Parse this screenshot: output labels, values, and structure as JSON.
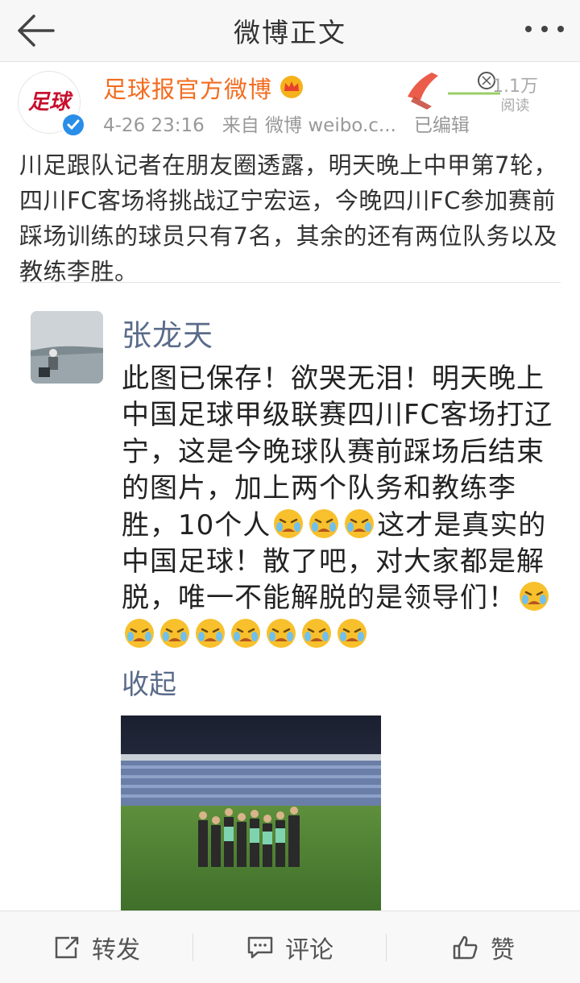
{
  "nav": {
    "title": "微博正文"
  },
  "post": {
    "author": "足球报官方微博",
    "avatar_text": "足球",
    "date": "4-26 23:16",
    "source": "来自 微博 weibo.c...",
    "edited": "已编辑",
    "reads": "1.1万",
    "reads_label": "阅读",
    "text": "川足跟队记者在朋友圈透露，明天晚上中甲第7轮，四川FC客场将挑战辽宁宏运，今晚四川FC参加赛前踩场训练的球员只有7名，其余的还有两位队务以及教练李胜。"
  },
  "embedded": {
    "name": "张龙天",
    "text_part1": "此图已保存！欲哭无泪！明天晚上中国足球甲级联赛四川FC客场打辽宁，这是今晚球队赛前踩场后结束的图片，加上两个队务和教练李胜，10个人",
    "text_part2": "这才是真实的中国足球！散了吧，对大家都是解脱，唯一不能解脱的是领导们！",
    "collapse": "收起"
  },
  "actions": {
    "repost": "转发",
    "comment": "评论",
    "like": "赞"
  },
  "colors": {
    "author": "#f36c1f",
    "link": "#5a6b8a",
    "verified": "#2a8ee8"
  },
  "icons": [
    "back-arrow-icon",
    "more-dots-icon",
    "crown-icon",
    "verified-icon",
    "crying-emoji-icon",
    "repost-icon",
    "comment-icon",
    "like-icon"
  ]
}
